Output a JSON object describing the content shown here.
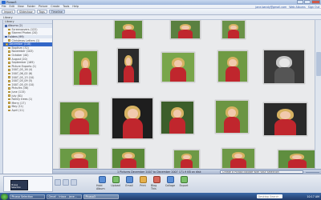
{
  "window": {
    "title": "Picasa3"
  },
  "menu": [
    "File",
    "Edit",
    "View",
    "Folder",
    "Picture",
    "Create",
    "Tools",
    "Help"
  ],
  "account": {
    "email": "jane.bandy@gmail.com",
    "sign_out": "Sign Out",
    "web_albums": "Web Albums"
  },
  "toolbar": {
    "import": "Import",
    "slideshow": "Slideshow",
    "tags": "Tags",
    "timeline": "Timeline"
  },
  "filter": {
    "label": "Library"
  },
  "sidebar": {
    "header": "Library",
    "items": [
      {
        "label": "Albums (2)",
        "kind": "group"
      },
      {
        "label": "Screensavers (122)",
        "kind": "sub"
      },
      {
        "label": "Starred Photos (20)",
        "kind": "sub"
      },
      {
        "label": "Folders (99)",
        "kind": "group"
      },
      {
        "label": "Christmas Letters (1)",
        "kind": "sub"
      },
      {
        "label": "December (118)",
        "kind": "sel"
      },
      {
        "label": "Baptism (32)",
        "kind": "sub"
      },
      {
        "label": "November (103)",
        "kind": "sub"
      },
      {
        "label": "October (40)",
        "kind": "sub"
      },
      {
        "label": "August (20)",
        "kind": "sub"
      },
      {
        "label": "September (169)",
        "kind": "sub"
      },
      {
        "label": "Picture Exports (1)",
        "kind": "sub"
      },
      {
        "label": "2007_05_16 (4)",
        "kind": "sub"
      },
      {
        "label": "2007_06_02 (6)",
        "kind": "sub"
      },
      {
        "label": "2007_05_13 (10)",
        "kind": "sub"
      },
      {
        "label": "2007_05_09 (5)",
        "kind": "sub"
      },
      {
        "label": "2007_05_05 (10)",
        "kind": "sub"
      },
      {
        "label": "Pictures (38)",
        "kind": "sub"
      },
      {
        "label": "June (115)",
        "kind": "sub"
      },
      {
        "label": "July (81)",
        "kind": "sub"
      },
      {
        "label": "Family trees (1)",
        "kind": "sub"
      },
      {
        "label": "Merry (17)",
        "kind": "sub"
      },
      {
        "label": "May (11)",
        "kind": "sub"
      },
      {
        "label": "April (11)",
        "kind": "sub"
      }
    ]
  },
  "tray": {
    "count": "1 Pictures",
    "range": "December 2007 to December 2007",
    "size": "171.9 KB on disk",
    "prompt": "Create a Picasa collage with your selection"
  },
  "actions": [
    {
      "label": "Hold Album",
      "color": "b"
    },
    {
      "label": "Upload",
      "color": "g"
    },
    {
      "label": "Email",
      "color": "b"
    },
    {
      "label": "Print",
      "color": "o"
    },
    {
      "label": "Blog This",
      "color": "r"
    },
    {
      "label": "Collage",
      "color": "b"
    },
    {
      "label": "Export",
      "color": "g"
    }
  ],
  "selection": {
    "caption": "Picasa Selection"
  },
  "taskbar": {
    "tasks": [
      "Picasa Selection",
      "Gmail - Inbox - jane...",
      "Picasa3"
    ],
    "search_placeholder": "Desktop Search",
    "clock": "10:17 AM"
  }
}
